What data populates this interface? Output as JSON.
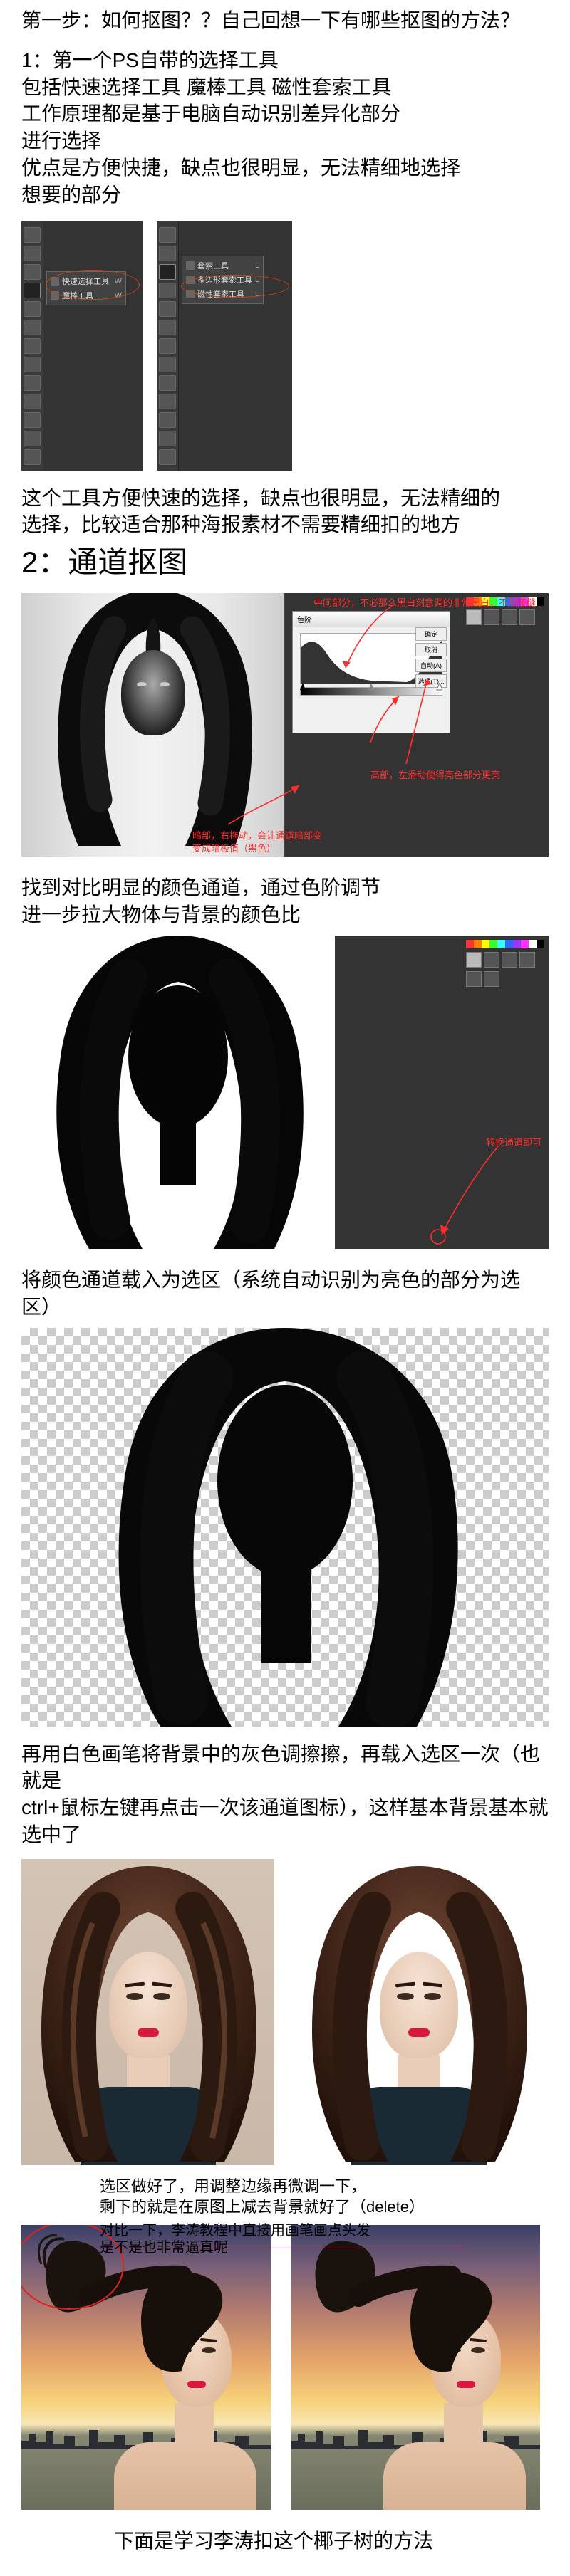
{
  "intro": {
    "title": "第一步：如何抠图？？自己回想一下有哪些抠图的方法？",
    "method1_title": "1：第一个PS自带的选择工具",
    "method1_line2": "包括快速选择工具 魔棒工具 磁性套索工具",
    "method1_line3": "工作原理都是基于电脑自动识别差异化部分",
    "method1_line4": "进行选择",
    "method1_line5": "优点是方便快捷，缺点也很明显，无法精细地选择",
    "method1_line6": "想要的部分"
  },
  "flyout_left": {
    "items": [
      "快速选择工具",
      "魔棒工具"
    ],
    "key": "W"
  },
  "flyout_right": {
    "items": [
      "套索工具",
      "多边形套索工具",
      "磁性套索工具"
    ],
    "key": "L"
  },
  "after_tools": {
    "p1": "这个工具方便快速的选择，缺点也很明显，无法精细的",
    "p2": "选择，比较适合那种海报素材不需要精细扣的地方"
  },
  "section2_title": "2：通道抠图",
  "stage1": {
    "anno_top": "中间部分，不必那么黑白刻意调的非常黑白，不然接缝",
    "anno_bottom": "高部，左滑动使得亮色部分更亮",
    "anno_left_1": "暗部，右拖动，会让通道暗部变",
    "anno_left_2": "变成暗极值（黑色）",
    "levels_title": "色阶",
    "levels_buttons": [
      "确定",
      "取消",
      "自动(A)",
      "选项(T)..."
    ]
  },
  "caption2a": "找到对比明显的颜色通道，通过色阶调节",
  "caption2b": "进一步拉大物体与背景的颜色比",
  "stage2_anno": "转换通道即可",
  "caption3": "将颜色通道载入为选区（系统自动识别为亮色的部分为选区）",
  "caption4a": "再用白色画笔将背景中的灰色调擦擦，再载入选区一次（也就是",
  "caption4b": "ctrl+鼠标左键再点击一次该通道图标），这样基本背景基本就选中了",
  "caption5a": "选区做好了，用调整边缘再微调一下，",
  "caption5b": "剩下的就是在原图上减去背景就好了（delete）",
  "compare_l1": "对比一下，李涛教程中直接用画笔画点头发",
  "compare_l2": "是不是也非常逼真呢",
  "final": "下面是学习李涛扣这个椰子树的方法"
}
